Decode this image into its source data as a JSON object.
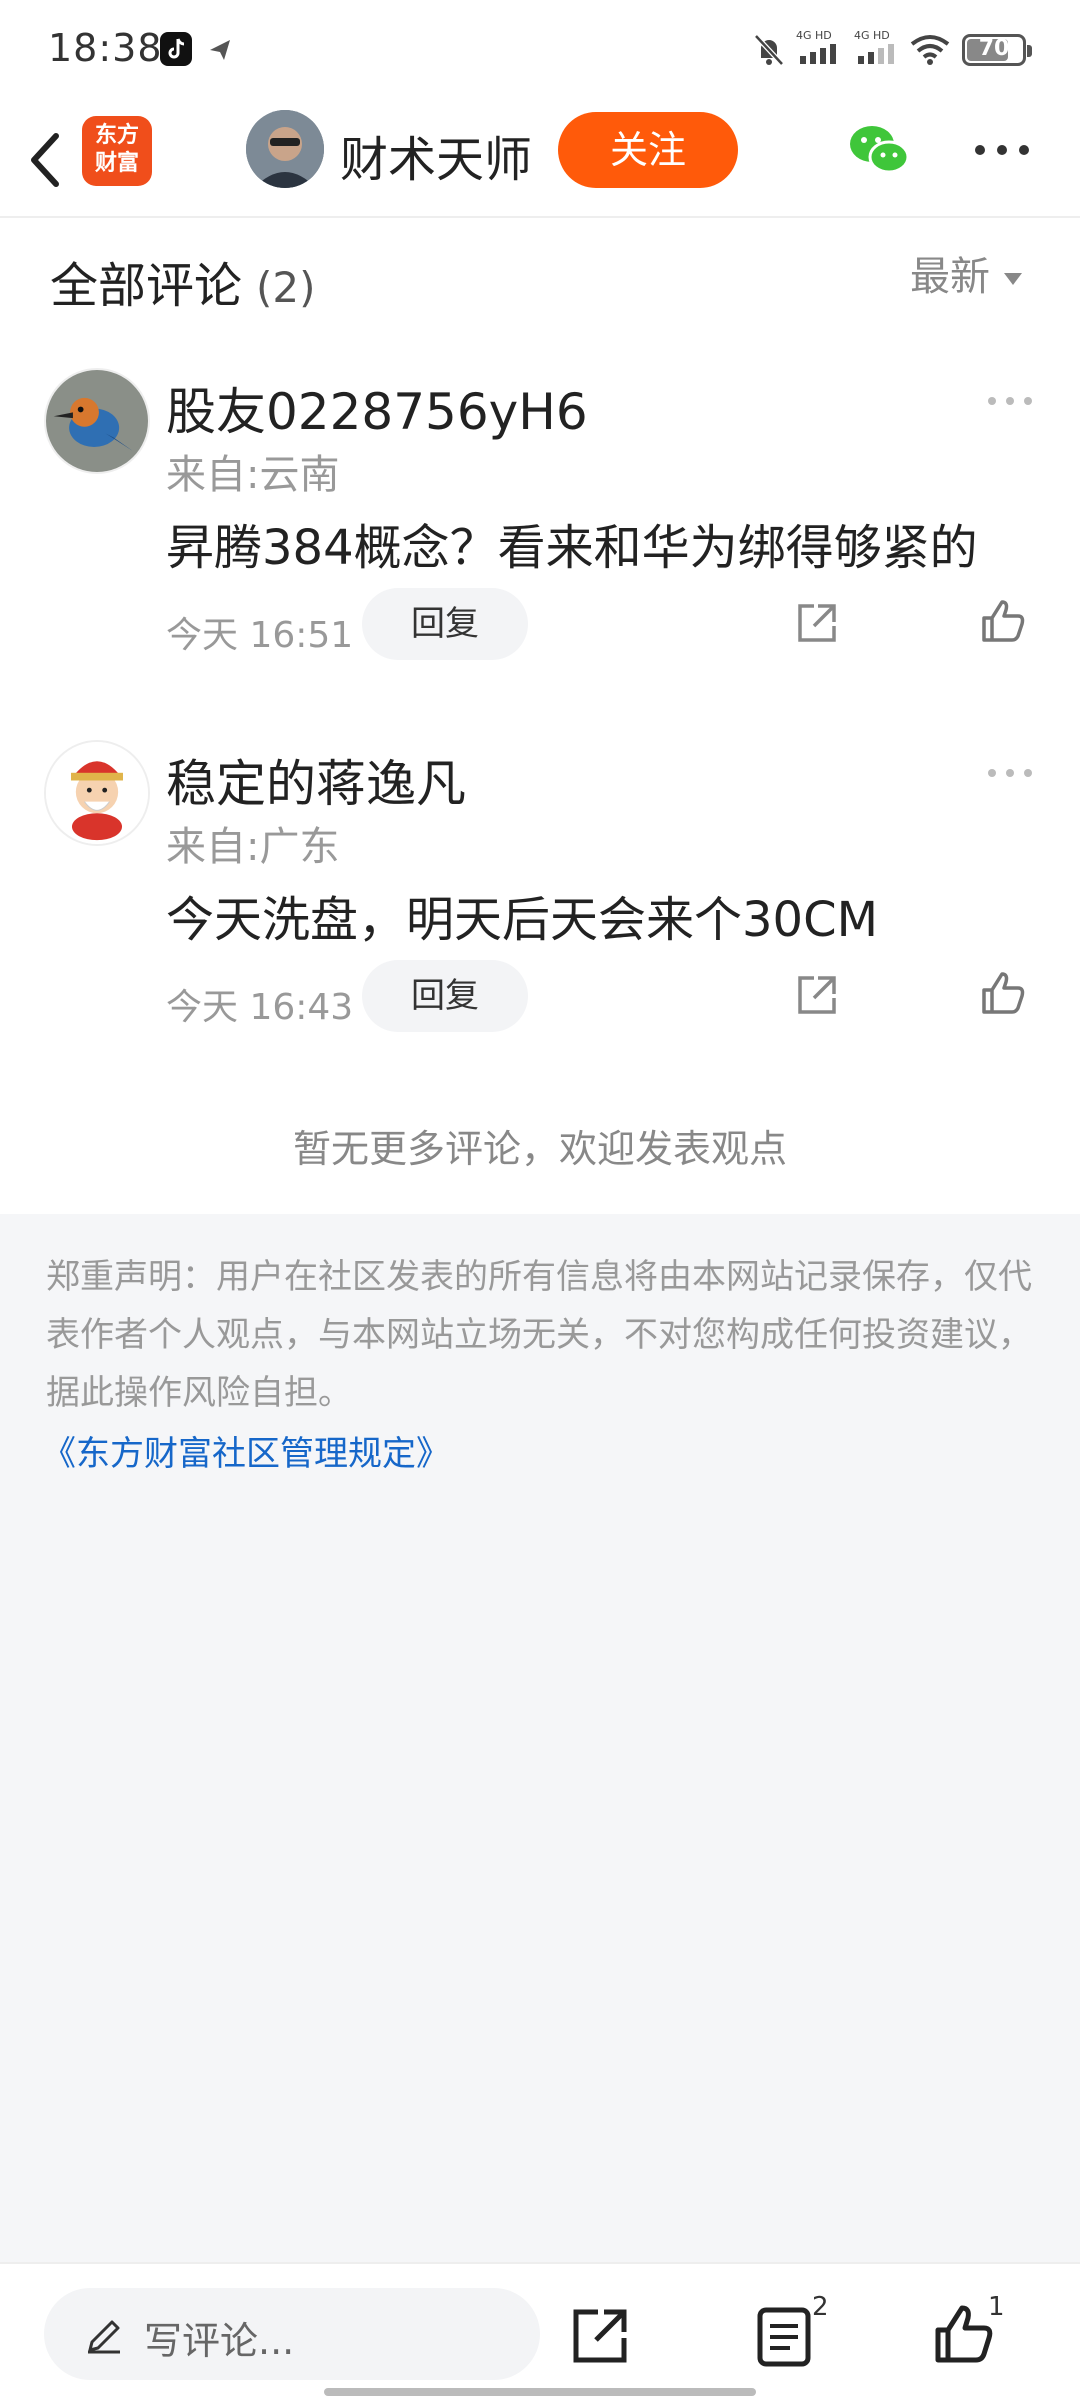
{
  "status_bar": {
    "time": "18:38",
    "network1": "4G HD",
    "network2": "4G HD",
    "battery": "70"
  },
  "header": {
    "app_logo_line1": "东方",
    "app_logo_line2": "财富",
    "author_name": "财术天师",
    "follow_label": "关注"
  },
  "comments_section": {
    "title": "全部评论",
    "count": "(2)",
    "sort_label": "最新",
    "comments": [
      {
        "user": "股友0228756yH6",
        "location": "来自:云南",
        "text": "昇腾384概念？看来和华为绑得够紧的",
        "time": "今天 16:51",
        "reply_label": "回复"
      },
      {
        "user": "稳定的蒋逸凡",
        "location": "来自:广东",
        "text": "今天洗盘，明天后天会来个30CM",
        "time": "今天 16:43",
        "reply_label": "回复"
      }
    ],
    "no_more": "暂无更多评论，欢迎发表观点"
  },
  "disclaimer": {
    "text": "郑重声明：用户在社区发表的所有信息将由本网站记录保存，仅代表作者个人观点，与本网站立场无关，不对您构成任何投资建议，据此操作风险自担。",
    "rules_link": "《东方财富社区管理规定》"
  },
  "bottom_bar": {
    "input_placeholder": "写评论...",
    "comment_count": "2",
    "like_count": "1"
  },
  "colors": {
    "accent": "#ff5a0a",
    "logo": "#f04e1b",
    "link": "#1667c9",
    "wechat": "#3fc63a"
  }
}
